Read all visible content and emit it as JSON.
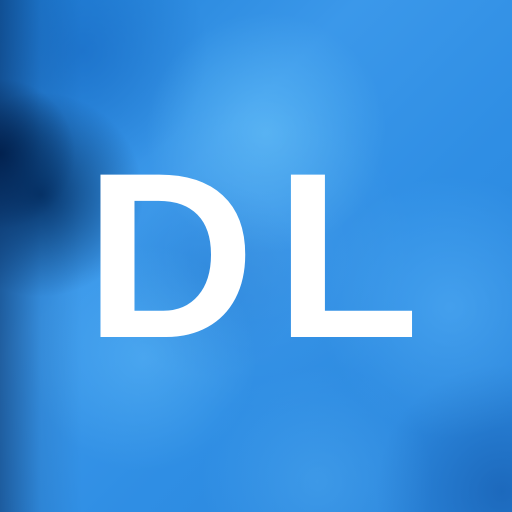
{
  "avatar": {
    "initials": "DL",
    "text_color": "#ffffff",
    "background_color": "#2f8fe0"
  }
}
